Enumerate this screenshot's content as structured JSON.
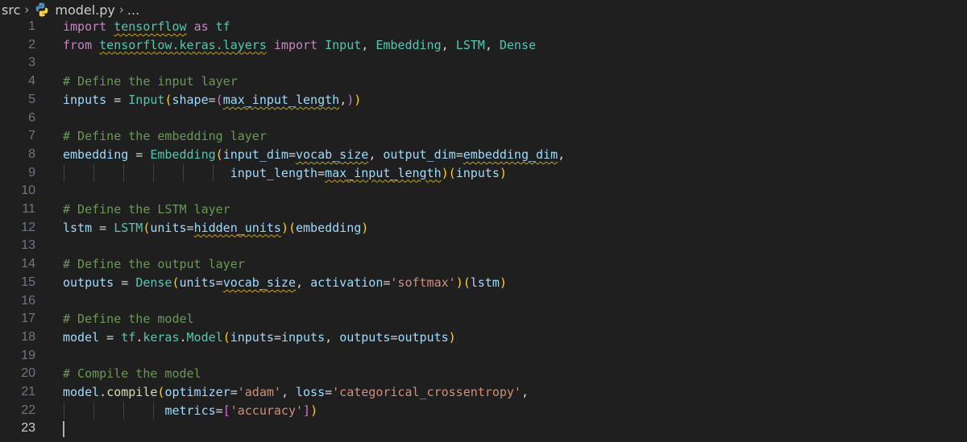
{
  "breadcrumb": {
    "folder": "src",
    "file": "model.py",
    "more": "..."
  },
  "editor": {
    "active_line": 23,
    "lines": [
      [
        {
          "t": "import ",
          "c": "kw"
        },
        {
          "t": "tensorflow",
          "c": "cls",
          "sq": true
        },
        {
          "t": " ",
          "c": "op"
        },
        {
          "t": "as",
          "c": "kw"
        },
        {
          "t": " ",
          "c": "op"
        },
        {
          "t": "tf",
          "c": "cls"
        }
      ],
      [
        {
          "t": "from ",
          "c": "kw"
        },
        {
          "t": "tensorflow.keras.layers",
          "c": "cls",
          "sq": true
        },
        {
          "t": " ",
          "c": "op"
        },
        {
          "t": "import",
          "c": "kw"
        },
        {
          "t": " ",
          "c": "op"
        },
        {
          "t": "Input",
          "c": "cls"
        },
        {
          "t": ", ",
          "c": "op"
        },
        {
          "t": "Embedding",
          "c": "cls"
        },
        {
          "t": ", ",
          "c": "op"
        },
        {
          "t": "LSTM",
          "c": "cls"
        },
        {
          "t": ", ",
          "c": "op"
        },
        {
          "t": "Dense",
          "c": "cls"
        }
      ],
      [],
      [
        {
          "t": "# Define the input layer",
          "c": "cm"
        }
      ],
      [
        {
          "t": "inputs",
          "c": "var"
        },
        {
          "t": " = ",
          "c": "op"
        },
        {
          "t": "Input",
          "c": "cls"
        },
        {
          "t": "(",
          "c": "br1"
        },
        {
          "t": "shape",
          "c": "var"
        },
        {
          "t": "=",
          "c": "op"
        },
        {
          "t": "(",
          "c": "br2"
        },
        {
          "t": "max_input_length",
          "c": "var",
          "sq": true
        },
        {
          "t": ",",
          "c": "op"
        },
        {
          "t": ")",
          "c": "br2"
        },
        {
          "t": ")",
          "c": "br1"
        }
      ],
      [],
      [
        {
          "t": "# Define the embedding layer",
          "c": "cm"
        }
      ],
      [
        {
          "t": "embedding",
          "c": "var"
        },
        {
          "t": " = ",
          "c": "op"
        },
        {
          "t": "Embedding",
          "c": "cls"
        },
        {
          "t": "(",
          "c": "br1"
        },
        {
          "t": "input_dim",
          "c": "var"
        },
        {
          "t": "=",
          "c": "op"
        },
        {
          "t": "vocab_size",
          "c": "var",
          "sq": true
        },
        {
          "t": ", ",
          "c": "op"
        },
        {
          "t": "output_dim",
          "c": "var"
        },
        {
          "t": "=",
          "c": "op"
        },
        {
          "t": "embedding_dim",
          "c": "var",
          "sq": true
        },
        {
          "t": ",",
          "c": "op"
        }
      ],
      [
        {
          "t": "                       ",
          "c": "op"
        },
        {
          "t": "input_length",
          "c": "var"
        },
        {
          "t": "=",
          "c": "op"
        },
        {
          "t": "max_input_length",
          "c": "var",
          "sq": true
        },
        {
          "t": ")",
          "c": "br1"
        },
        {
          "t": "(",
          "c": "br1"
        },
        {
          "t": "inputs",
          "c": "var"
        },
        {
          "t": ")",
          "c": "br1"
        }
      ],
      [],
      [
        {
          "t": "# Define the LSTM layer",
          "c": "cm"
        }
      ],
      [
        {
          "t": "lstm",
          "c": "var"
        },
        {
          "t": " = ",
          "c": "op"
        },
        {
          "t": "LSTM",
          "c": "cls"
        },
        {
          "t": "(",
          "c": "br1"
        },
        {
          "t": "units",
          "c": "var"
        },
        {
          "t": "=",
          "c": "op"
        },
        {
          "t": "hidden_units",
          "c": "var",
          "sq": true
        },
        {
          "t": ")",
          "c": "br1"
        },
        {
          "t": "(",
          "c": "br1"
        },
        {
          "t": "embedding",
          "c": "var"
        },
        {
          "t": ")",
          "c": "br1"
        }
      ],
      [],
      [
        {
          "t": "# Define the output layer",
          "c": "cm"
        }
      ],
      [
        {
          "t": "outputs",
          "c": "var"
        },
        {
          "t": " = ",
          "c": "op"
        },
        {
          "t": "Dense",
          "c": "cls"
        },
        {
          "t": "(",
          "c": "br1"
        },
        {
          "t": "units",
          "c": "var"
        },
        {
          "t": "=",
          "c": "op"
        },
        {
          "t": "vocab_size",
          "c": "var",
          "sq": true
        },
        {
          "t": ", ",
          "c": "op"
        },
        {
          "t": "activation",
          "c": "var"
        },
        {
          "t": "=",
          "c": "op"
        },
        {
          "t": "'softmax'",
          "c": "str"
        },
        {
          "t": ")",
          "c": "br1"
        },
        {
          "t": "(",
          "c": "br1"
        },
        {
          "t": "lstm",
          "c": "var"
        },
        {
          "t": ")",
          "c": "br1"
        }
      ],
      [],
      [
        {
          "t": "# Define the model",
          "c": "cm"
        }
      ],
      [
        {
          "t": "model",
          "c": "var"
        },
        {
          "t": " = ",
          "c": "op"
        },
        {
          "t": "tf",
          "c": "cls"
        },
        {
          "t": ".",
          "c": "op"
        },
        {
          "t": "keras",
          "c": "cls"
        },
        {
          "t": ".",
          "c": "op"
        },
        {
          "t": "Model",
          "c": "cls"
        },
        {
          "t": "(",
          "c": "br1"
        },
        {
          "t": "inputs",
          "c": "var"
        },
        {
          "t": "=",
          "c": "op"
        },
        {
          "t": "inputs",
          "c": "var"
        },
        {
          "t": ", ",
          "c": "op"
        },
        {
          "t": "outputs",
          "c": "var"
        },
        {
          "t": "=",
          "c": "op"
        },
        {
          "t": "outputs",
          "c": "var"
        },
        {
          "t": ")",
          "c": "br1"
        }
      ],
      [],
      [
        {
          "t": "# Compile the model",
          "c": "cm"
        }
      ],
      [
        {
          "t": "model",
          "c": "var"
        },
        {
          "t": ".",
          "c": "op"
        },
        {
          "t": "compile",
          "c": "fn"
        },
        {
          "t": "(",
          "c": "br1"
        },
        {
          "t": "optimizer",
          "c": "var"
        },
        {
          "t": "=",
          "c": "op"
        },
        {
          "t": "'adam'",
          "c": "str"
        },
        {
          "t": ", ",
          "c": "op"
        },
        {
          "t": "loss",
          "c": "var"
        },
        {
          "t": "=",
          "c": "op"
        },
        {
          "t": "'categorical_crossentropy'",
          "c": "str"
        },
        {
          "t": ",",
          "c": "op"
        }
      ],
      [
        {
          "t": "              ",
          "c": "op"
        },
        {
          "t": "metrics",
          "c": "var"
        },
        {
          "t": "=",
          "c": "op"
        },
        {
          "t": "[",
          "c": "br2"
        },
        {
          "t": "'accuracy'",
          "c": "str"
        },
        {
          "t": "]",
          "c": "br2"
        },
        {
          "t": ")",
          "c": "br1"
        }
      ],
      []
    ]
  }
}
